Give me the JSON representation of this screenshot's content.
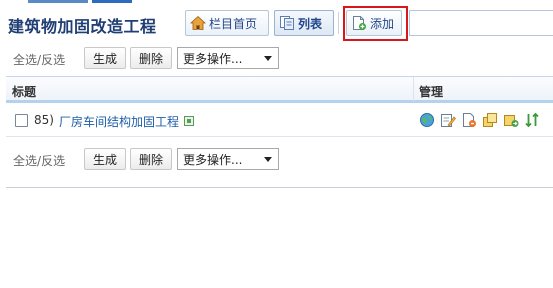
{
  "page": {
    "title": "建筑物加固改造工程"
  },
  "toolbar": {
    "home_label": "栏目首页",
    "list_label": "列表",
    "add_label": "添加",
    "search_value": ""
  },
  "actions": {
    "select_all": "全选",
    "separator": "/",
    "invert": "反选",
    "generate": "生成",
    "delete": "删除",
    "more": "更多操作..."
  },
  "table": {
    "columns": [
      "标题",
      "管理"
    ],
    "rows": [
      {
        "number": "85)",
        "title": "厂房车间结构加固工程",
        "manage_icons": [
          "globe-icon",
          "edit-icon",
          "document-icon",
          "copy-icon",
          "move-icon",
          "sort-icon"
        ]
      }
    ]
  },
  "colors": {
    "title": "#1f3e74",
    "link": "#1d5ea8",
    "highlight_border": "#d9161c",
    "header_underline": "#b3d2ee"
  }
}
